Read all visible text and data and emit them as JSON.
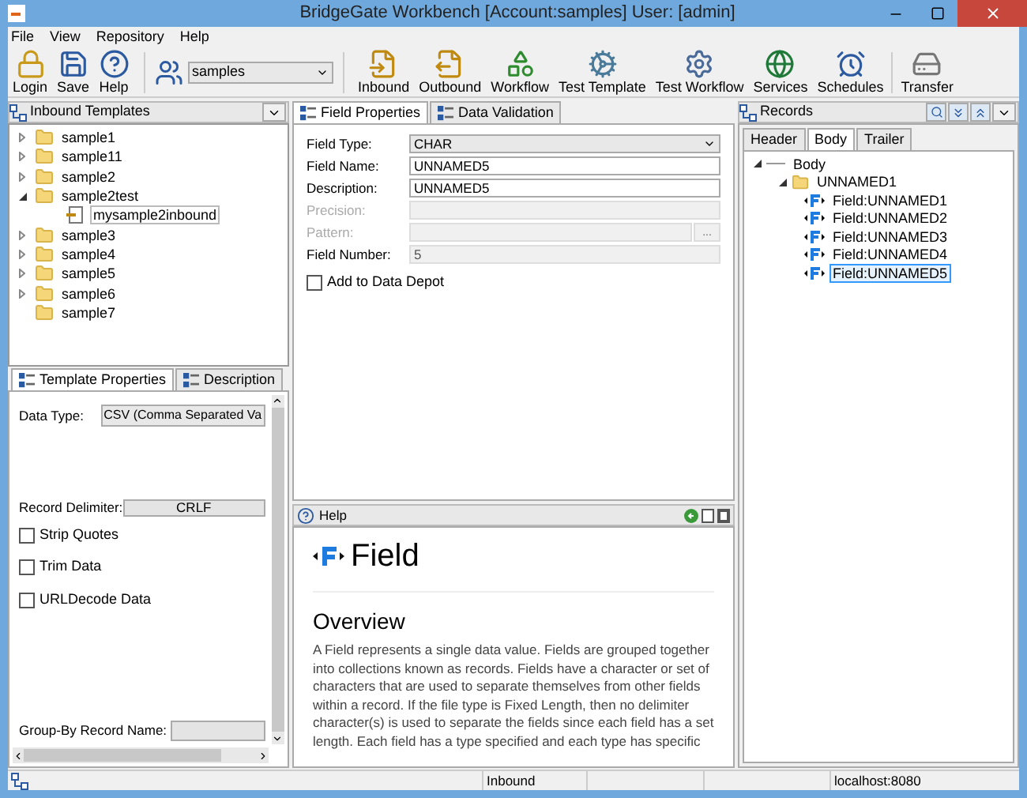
{
  "window": {
    "title": "BridgeGate Workbench [Account:samples] User: [admin]"
  },
  "menu": [
    "File",
    "View",
    "Repository",
    "Help"
  ],
  "toolbar": {
    "left": [
      {
        "label": "Login",
        "kind": "lock"
      },
      {
        "label": "Save",
        "kind": "disk"
      },
      {
        "label": "Help",
        "kind": "help"
      }
    ],
    "account": {
      "value": "samples"
    },
    "right": [
      {
        "label": "Inbound",
        "kind": "inbound"
      },
      {
        "label": "Outbound",
        "kind": "outbound"
      },
      {
        "label": "Workflow",
        "kind": "shapes"
      },
      {
        "label": "Test Template",
        "kind": "gear"
      },
      {
        "label": "Test Workflow",
        "kind": "gear2"
      },
      {
        "label": "Services",
        "kind": "globe"
      },
      {
        "label": "Schedules",
        "kind": "clock"
      },
      {
        "label": "Transfer",
        "kind": "transfer"
      }
    ]
  },
  "templates": {
    "title": "Inbound Templates",
    "items": [
      {
        "label": "sample1",
        "expandable": true,
        "expanded": false,
        "selected": false
      },
      {
        "label": "sample11",
        "expandable": true,
        "expanded": false,
        "selected": false
      },
      {
        "label": "sample2",
        "expandable": true,
        "expanded": false,
        "selected": false
      },
      {
        "label": "sample2test",
        "expandable": true,
        "expanded": true,
        "selected": false,
        "children": [
          {
            "label": "mysample2inbound",
            "expandable": false,
            "expanded": false,
            "selected": true
          }
        ]
      },
      {
        "label": "sample3",
        "expandable": true,
        "expanded": false,
        "selected": false
      },
      {
        "label": "sample4",
        "expandable": true,
        "expanded": false,
        "selected": false
      },
      {
        "label": "sample5",
        "expandable": true,
        "expanded": false,
        "selected": false
      },
      {
        "label": "sample6",
        "expandable": true,
        "expanded": false,
        "selected": false
      },
      {
        "label": "sample7",
        "expandable": false,
        "expanded": false,
        "selected": false
      }
    ]
  },
  "template_tabs": [
    {
      "label": "Template Properties",
      "selected": true
    },
    {
      "label": "Description",
      "selected": false
    }
  ],
  "template_properties": {
    "data_type_label": "Data Type:",
    "data_type": "CSV (Comma Separated Va",
    "record_delimiter_label": "Record Delimiter:",
    "record_delimiter": "CRLF",
    "options": [
      {
        "label": "Strip Quotes",
        "checked": false
      },
      {
        "label": "Trim Data",
        "checked": false
      },
      {
        "label": "URLDecode Data",
        "checked": false
      }
    ],
    "group_by_label": "Group-By Record Name:"
  },
  "field_tabs": [
    {
      "label": "Field Properties",
      "selected": true
    },
    {
      "label": "Data Validation",
      "selected": false
    }
  ],
  "field_properties": [
    {
      "label": "Field Type:",
      "kind": "select",
      "value": "CHAR",
      "disabled": false
    },
    {
      "label": "Field Name:",
      "kind": "text",
      "value": "UNNAMED5",
      "disabled": false
    },
    {
      "label": "Description:",
      "kind": "text",
      "value": "UNNAMED5",
      "disabled": false
    },
    {
      "label": "Precision:",
      "kind": "text",
      "disabled": true
    },
    {
      "label": "Pattern:",
      "kind": "browse",
      "button": "...",
      "disabled": true
    },
    {
      "label": "Field Number:",
      "kind": "text",
      "value": "5",
      "disabled": true
    }
  ],
  "add_to_depot": {
    "label": "Add to Data Depot",
    "checked": false
  },
  "help": {
    "title": "Help",
    "heading": "Field",
    "subheading": "Overview",
    "body": "A Field represents a single data value. Fields are grouped together into collections known as records. Fields have a character or set of characters that are used to separate themselves from other fields within a record. If the file type is Fixed Length, then no delimiter character(s) is used to separate the fields since each field has a set length. Each field has a type specified and each type has specific"
  },
  "records": {
    "title": "Records",
    "tabs": [
      {
        "label": "Header",
        "selected": false
      },
      {
        "label": "Body",
        "selected": true
      },
      {
        "label": "Trailer",
        "selected": false
      }
    ],
    "tree": [
      {
        "label": "Body",
        "kind": "root",
        "selected": false,
        "children": [
          {
            "label": "UNNAMED1",
            "kind": "folder",
            "selected": false,
            "children": [
              {
                "label": "Field:UNNAMED1",
                "kind": "field",
                "selected": false
              },
              {
                "label": "Field:UNNAMED2",
                "kind": "field",
                "selected": false
              },
              {
                "label": "Field:UNNAMED3",
                "kind": "field",
                "selected": false
              },
              {
                "label": "Field:UNNAMED4",
                "kind": "field",
                "selected": false
              },
              {
                "label": "Field:UNNAMED5",
                "kind": "field",
                "selected": true
              }
            ]
          }
        ]
      }
    ]
  },
  "status_bar": [
    "Inbound",
    "localhost:8080"
  ]
}
